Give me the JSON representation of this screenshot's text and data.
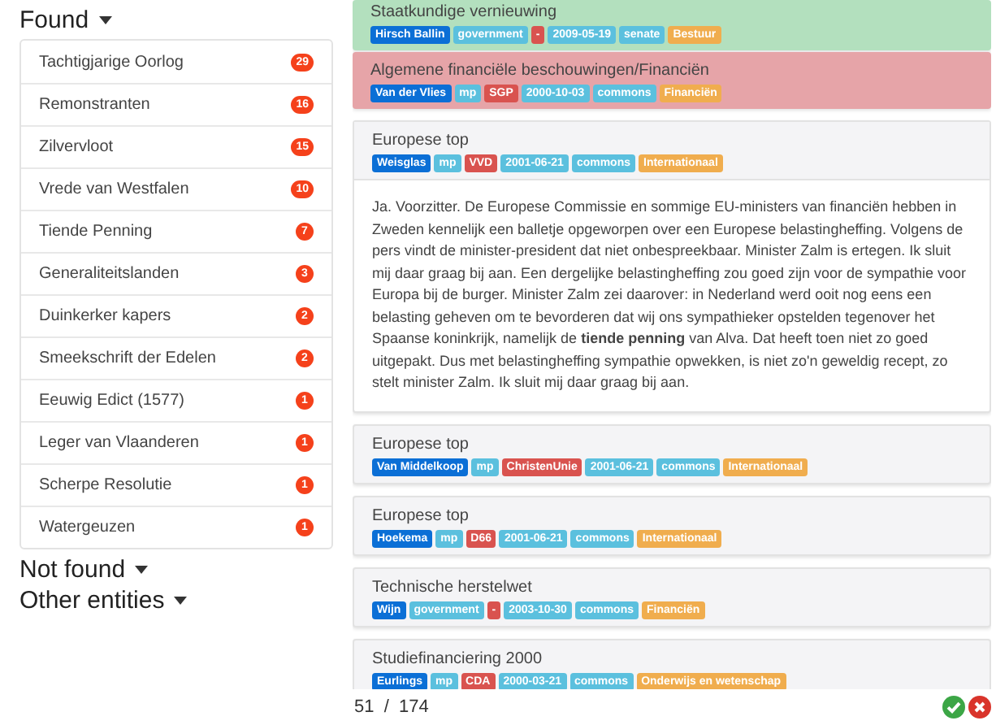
{
  "sections": [
    {
      "title": "Found",
      "items": [
        {
          "label": "Tachtigjarige Oorlog",
          "count": "29"
        },
        {
          "label": "Remonstranten",
          "count": "16"
        },
        {
          "label": "Zilvervloot",
          "count": "15"
        },
        {
          "label": "Vrede van Westfalen",
          "count": "10"
        },
        {
          "label": "Tiende Penning",
          "count": "7"
        },
        {
          "label": "Generaliteitslanden",
          "count": "3"
        },
        {
          "label": "Duinkerker kapers",
          "count": "2"
        },
        {
          "label": "Smeekschrift der Edelen",
          "count": "2"
        },
        {
          "label": "Eeuwig Edict (1577)",
          "count": "1"
        },
        {
          "label": "Leger van Vlaanderen",
          "count": "1"
        },
        {
          "label": "Scherpe Resolutie",
          "count": "1"
        },
        {
          "label": "Watergeuzen",
          "count": "1"
        }
      ]
    },
    {
      "title": "Not found"
    },
    {
      "title": "Other entities"
    }
  ],
  "results": [
    {
      "title": "Staatkundige vernieuwing",
      "accepted": true,
      "rejected": false,
      "tags": [
        {
          "kind": "person",
          "text": "Hirsch Ballin"
        },
        {
          "kind": "role",
          "text": "government"
        },
        {
          "kind": "party",
          "text": "-"
        },
        {
          "kind": "date",
          "text": "2009-05-19"
        },
        {
          "kind": "house",
          "text": "senate"
        },
        {
          "kind": "topic",
          "text": "Bestuur"
        }
      ]
    },
    {
      "title": "Algemene financiële beschouwingen/Financiën",
      "accepted": false,
      "rejected": true,
      "tags": [
        {
          "kind": "person",
          "text": "Van der Vlies"
        },
        {
          "kind": "role",
          "text": "mp"
        },
        {
          "kind": "party",
          "text": "SGP"
        },
        {
          "kind": "date",
          "text": "2000-10-03"
        },
        {
          "kind": "house",
          "text": "commons"
        },
        {
          "kind": "topic",
          "text": "Financiën"
        }
      ]
    },
    {
      "title": "Europese top",
      "accepted": false,
      "rejected": false,
      "tags": [
        {
          "kind": "person",
          "text": "Weisglas"
        },
        {
          "kind": "role",
          "text": "mp"
        },
        {
          "kind": "party",
          "text": "VVD"
        },
        {
          "kind": "date",
          "text": "2001-06-21"
        },
        {
          "kind": "house",
          "text": "commons"
        },
        {
          "kind": "topic",
          "text": "Internationaal"
        }
      ],
      "text": "Ja. Voorzitter. De Europese Commissie en sommige EU-ministers van financiën hebben in Zweden kennelijk een balletje opgeworpen over een Europese belastingheffing. Volgens de pers vindt de minister-president dat niet onbespreekbaar. Minister Zalm is ertegen. Ik sluit mij daar graag bij aan. Een dergelijke belastingheffing zou goed zijn voor de sympathie voor Europa bij de burger. Minister Zalm zei daarover: in Nederland werd ooit nog eens een belasting geheven om te bevorderen dat wij ons sympathieker opstelden tegenover het Spaanse koninkrijk, namelijk de **tiende penning** van Alva. Dat heeft toen niet zo goed uitgepakt. Dus met belastingheffing sympathie opwekken, is niet zo'n geweldig recept, zo stelt minister Zalm. Ik sluit mij daar graag bij aan."
    },
    {
      "title": "Europese top",
      "accepted": false,
      "rejected": false,
      "tags": [
        {
          "kind": "person",
          "text": "Van Middelkoop"
        },
        {
          "kind": "role",
          "text": "mp"
        },
        {
          "kind": "party",
          "text": "ChristenUnie"
        },
        {
          "kind": "date",
          "text": "2001-06-21"
        },
        {
          "kind": "house",
          "text": "commons"
        },
        {
          "kind": "topic",
          "text": "Internationaal"
        }
      ]
    },
    {
      "title": "Europese top",
      "accepted": false,
      "rejected": false,
      "tags": [
        {
          "kind": "person",
          "text": "Hoekema"
        },
        {
          "kind": "role",
          "text": "mp"
        },
        {
          "kind": "party",
          "text": "D66"
        },
        {
          "kind": "date",
          "text": "2001-06-21"
        },
        {
          "kind": "house",
          "text": "commons"
        },
        {
          "kind": "topic",
          "text": "Internationaal"
        }
      ]
    },
    {
      "title": "Technische herstelwet",
      "accepted": false,
      "rejected": false,
      "tags": [
        {
          "kind": "person",
          "text": "Wijn"
        },
        {
          "kind": "role",
          "text": "government"
        },
        {
          "kind": "party",
          "text": "-"
        },
        {
          "kind": "date",
          "text": "2003-10-30"
        },
        {
          "kind": "house",
          "text": "commons"
        },
        {
          "kind": "topic",
          "text": "Financiën"
        }
      ]
    },
    {
      "title": "Studiefinanciering 2000",
      "accepted": false,
      "rejected": false,
      "tags": [
        {
          "kind": "person",
          "text": "Eurlings"
        },
        {
          "kind": "role",
          "text": "mp"
        },
        {
          "kind": "party",
          "text": "CDA"
        },
        {
          "kind": "date",
          "text": "2000-03-21"
        },
        {
          "kind": "house",
          "text": "commons"
        },
        {
          "kind": "topic",
          "text": "Onderwijs en wetenschap"
        }
      ]
    }
  ],
  "pager": {
    "current": "51",
    "separator": "/",
    "total": "174"
  }
}
